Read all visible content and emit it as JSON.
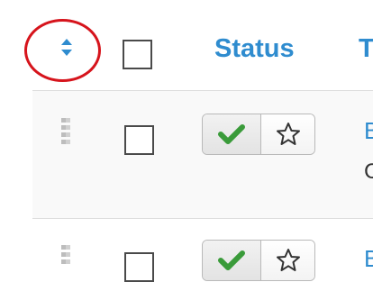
{
  "table": {
    "header": {
      "sort_icon": "sort-up-down-icon",
      "status_label": "Status",
      "title_label": "T"
    },
    "rows": [
      {
        "status": "published",
        "featured": false,
        "title_text": "B",
        "subtitle_text": "C"
      },
      {
        "status": "published",
        "featured": false,
        "title_text": "B"
      }
    ]
  },
  "colors": {
    "link_blue": "#2f8ccf",
    "check_green": "#3a9b3a",
    "annotation_red": "#d6141c"
  }
}
